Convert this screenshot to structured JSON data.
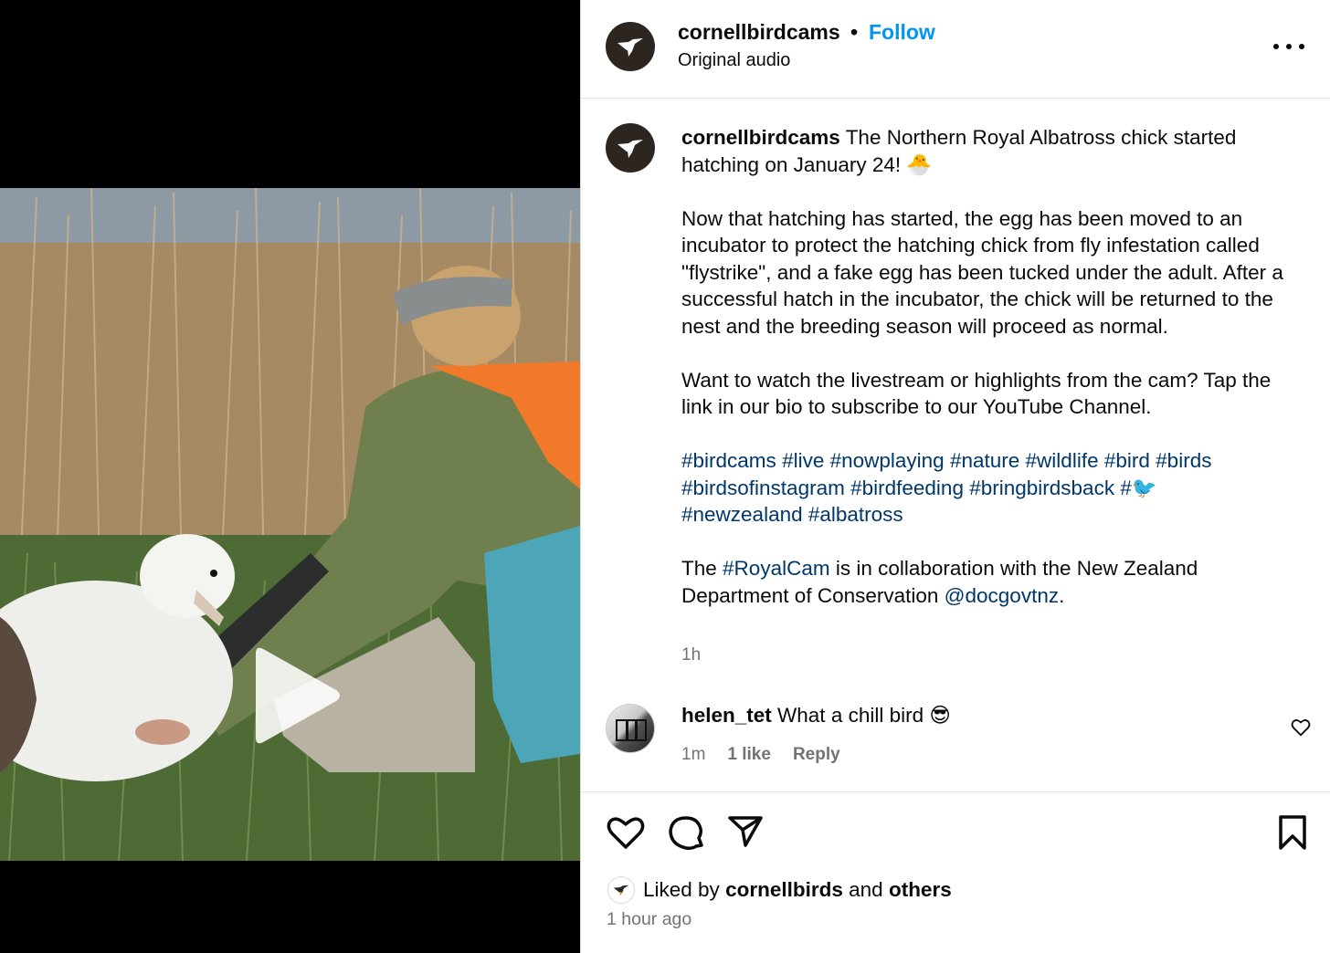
{
  "header": {
    "username": "cornellbirdcams",
    "separator": "•",
    "follow_label": "Follow",
    "audio_label": "Original audio"
  },
  "caption": {
    "username": "cornellbirdcams",
    "line1": "The Northern Royal Albatross chick started hatching on January 24! 🐣",
    "para2": "Now that hatching has started, the egg has been moved to an incubator to protect the hatching chick from fly infestation called \"flystrike\", and a fake egg has been tucked under the adult. After a successful hatch in the incubator, the chick will be returned to the nest and the breeding season will proceed as normal.",
    "para3": "Want to watch the livestream or highlights from the cam? Tap the link in our bio to subscribe to our YouTube Channel.",
    "hashtags": [
      "#birdcams",
      "#live",
      "#nowplaying",
      "#nature",
      "#wildlife",
      "#bird",
      "#birds",
      "#birdsofinstagram",
      "#birdfeeding",
      "#bringbirdsback",
      "#🐦",
      "#newzealand",
      "#albatross"
    ],
    "para5_prefix": "The",
    "para5_tag": "#RoyalCam",
    "para5_mid": "is in collaboration with the New Zealand Department of Conservation",
    "para5_mention": "@docgovtnz",
    "para5_suffix": ".",
    "time": "1h"
  },
  "comment": {
    "username": "helen_tet",
    "text": "What a chill bird 😎",
    "time": "1m",
    "likes": "1 like",
    "reply_label": "Reply"
  },
  "footer": {
    "liked_prefix": "Liked by",
    "liked_user": "cornellbirds",
    "liked_and": "and",
    "liked_others": "others",
    "timestamp": "1 hour ago"
  },
  "icons": {
    "play": "play-icon",
    "more": "more-options-icon",
    "heart": "heart-icon",
    "comment": "comment-icon",
    "share": "share-icon",
    "save": "bookmark-icon"
  },
  "colors": {
    "follow": "#0095f6",
    "hashtag": "#00376b",
    "muted": "#737373"
  }
}
